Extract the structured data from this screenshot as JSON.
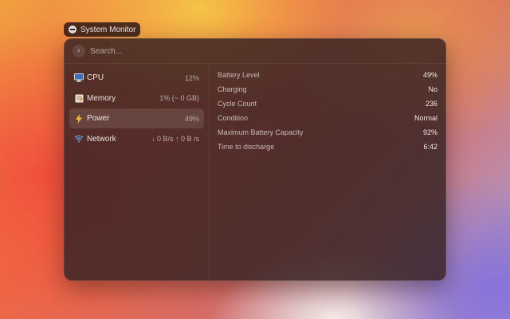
{
  "window_title": "System Monitor",
  "search": {
    "placeholder": "Search..."
  },
  "sidebar": {
    "items": [
      {
        "label": "CPU",
        "value": "12%",
        "icon": "monitor-icon"
      },
      {
        "label": "Memory",
        "value": "1% (~ 0 GB)",
        "icon": "memory-icon"
      },
      {
        "label": "Power",
        "value": "49%",
        "icon": "lightning-icon",
        "active": true
      },
      {
        "label": "Network",
        "value": "↓ 0 B/s ↑ 0 B /s",
        "icon": "wifi-icon"
      }
    ]
  },
  "details": {
    "rows": [
      {
        "key": "Battery Level",
        "value": "49%"
      },
      {
        "key": "Charging",
        "value": "No"
      },
      {
        "key": "Cycle Count",
        "value": "236"
      },
      {
        "key": "Condition",
        "value": "Normal"
      },
      {
        "key": "Maximum Battery Capacity",
        "value": "92%"
      },
      {
        "key": "Time to discharge",
        "value": "6:42"
      }
    ]
  },
  "colors": {
    "accent_lightning": "#f5c030",
    "wifi": "#5aa8f0"
  }
}
